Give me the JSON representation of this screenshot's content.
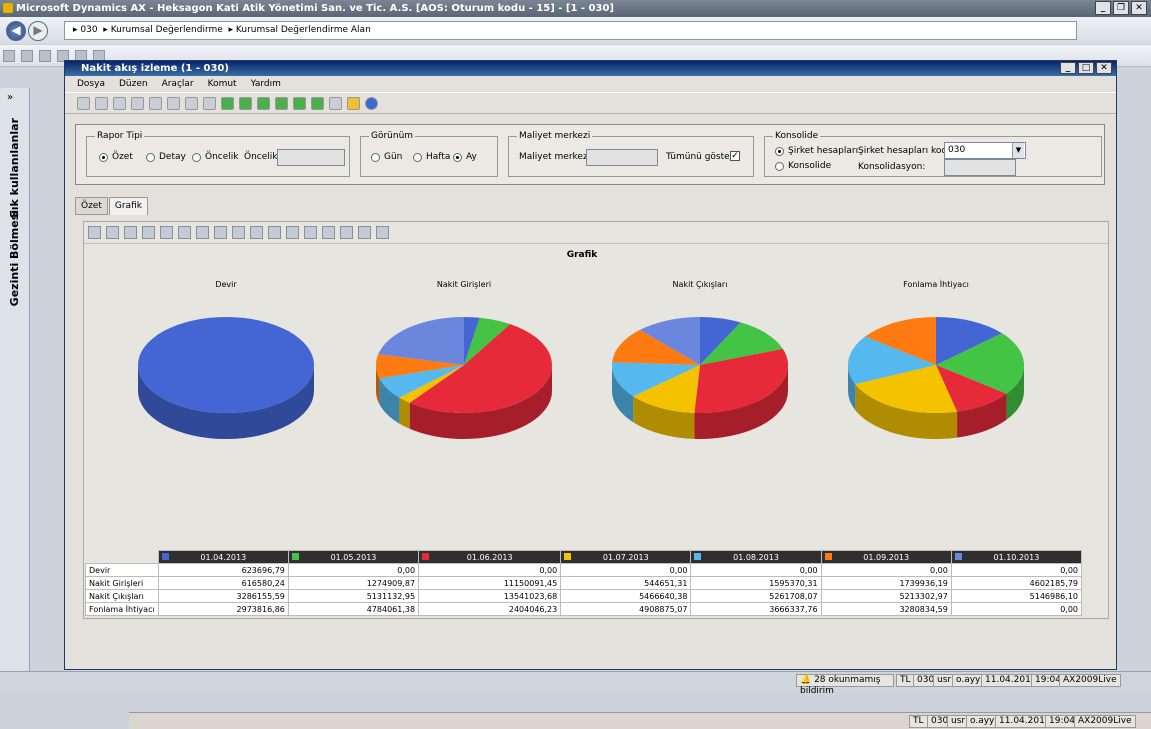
{
  "app": {
    "title": "Microsoft Dynamics AX - Heksagon Kati Atik Yönetimi San. ve Tic. A.S. [AOS: Oturum kodu - 15] - [1 - 030]"
  },
  "address": {
    "parts": [
      "030",
      "Kurumsal Değerlendirme",
      "Kurumsal Değerlendirme Alan"
    ]
  },
  "nav": {
    "side1": "Sık kullanılanlar",
    "side2": "Gezinti Bölmesi"
  },
  "modal": {
    "title": "Nakit akış izleme (1 - 030)",
    "menu": [
      "Dosya",
      "Düzen",
      "Araçlar",
      "Komut",
      "Yardım"
    ]
  },
  "filters": {
    "rapor_tipi": {
      "legend": "Rapor Tipi",
      "options": [
        "Özet",
        "Detay",
        "Öncelik"
      ],
      "selected": "Özet",
      "oncelik_label": "Öncelik:"
    },
    "gorunum": {
      "legend": "Görünüm",
      "options": [
        "Gün",
        "Hafta",
        "Ay"
      ],
      "selected": "Ay"
    },
    "maliyet": {
      "legend": "Maliyet merkezi",
      "label": "Maliyet merkezi:",
      "show_all": "Tümünü göster:",
      "checked": true
    },
    "konsolide": {
      "legend": "Konsolide",
      "options": [
        "Şirket hesapları",
        "Konsolide"
      ],
      "selected": "Şirket hesapları",
      "code_label": "Şirket hesapları kodu:",
      "code_value": "030",
      "cons_label": "Konsolidasyon:"
    }
  },
  "tabs": [
    "Özet",
    "Grafik"
  ],
  "chart_data": {
    "type": "pie",
    "title": "Grafik",
    "charts": [
      "Devir",
      "Nakit Girişleri",
      "Nakit Çıkışları",
      "Fonlama İhtiyacı"
    ],
    "categories": [
      "01.04.2013",
      "01.05.2013",
      "01.06.2013",
      "01.07.2013",
      "01.08.2013",
      "01.09.2013",
      "01.10.2013"
    ],
    "colors": [
      "#4466d4",
      "#44c444",
      "#e62a3a",
      "#f5c200",
      "#55b8ee",
      "#ff7a10",
      "#6a86dd"
    ],
    "rows": [
      {
        "label": "Devir",
        "values": [
          623696.79,
          0,
          0,
          0,
          0,
          0,
          0
        ],
        "display": [
          "623696,79",
          "0,00",
          "0,00",
          "0,00",
          "0,00",
          "0,00",
          "0,00"
        ]
      },
      {
        "label": "Nakit Girişleri",
        "values": [
          616580.24,
          1274909.87,
          11150091.45,
          544651.31,
          1595370.31,
          1739936.19,
          4602185.79
        ],
        "display": [
          "616580,24",
          "1274909,87",
          "11150091,45",
          "544651,31",
          "1595370,31",
          "1739936,19",
          "4602185,79"
        ]
      },
      {
        "label": "Nakit Çıkışları",
        "values": [
          3286155.59,
          5131132.95,
          13541023.68,
          5466640.38,
          5261708.07,
          5213302.97,
          5146986.1
        ],
        "display": [
          "3286155,59",
          "5131132,95",
          "13541023,68",
          "5466640,38",
          "5261708,07",
          "5213302,97",
          "5146986,10"
        ]
      },
      {
        "label": "Fonlama İhtiyacı",
        "values": [
          2973816.86,
          4784061.38,
          2404046.23,
          4908875.07,
          3666337.76,
          3280834.59,
          0
        ],
        "display": [
          "2973816,86",
          "4784061,38",
          "2404046,23",
          "4908875,07",
          "3666337,76",
          "3280834,59",
          "0,00"
        ]
      }
    ]
  },
  "status": {
    "currency": "TL",
    "company": "030",
    "user": "usr",
    "user2": "o.ayy",
    "date": "11.04.2013",
    "time": "19:04",
    "server": "AX2009Live",
    "notices": "28 okunmamış bildirim"
  }
}
